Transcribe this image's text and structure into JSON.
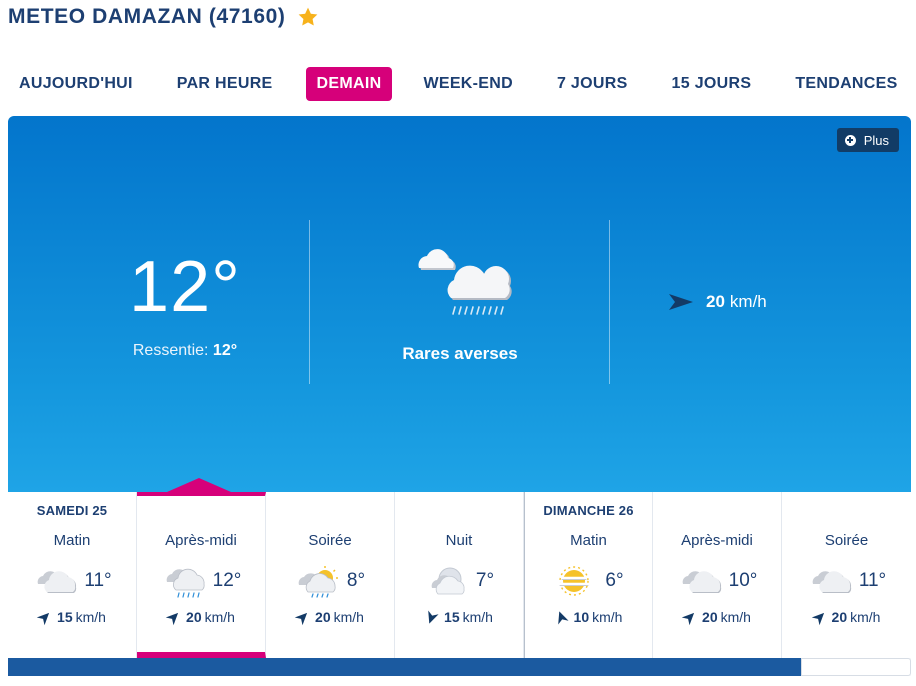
{
  "page": {
    "title": "METEO DAMAZAN (47160)",
    "favorite_icon": "star-icon",
    "accent_color": "#d6007a",
    "brand_color": "#1d3f72"
  },
  "tabs": [
    {
      "label": "AUJOURD'HUI",
      "active": false
    },
    {
      "label": "PAR HEURE",
      "active": false
    },
    {
      "label": "DEMAIN",
      "active": true
    },
    {
      "label": "WEEK-END",
      "active": false
    },
    {
      "label": "7 JOURS",
      "active": false
    },
    {
      "label": "15 JOURS",
      "active": false
    },
    {
      "label": "TENDANCES",
      "active": false
    }
  ],
  "hero": {
    "plus_label": "Plus",
    "temperature": "12°",
    "feels_label": "Ressentie:",
    "feels_value": "12°",
    "icon": "cloud-shower-icon",
    "description": "Rares averses",
    "wind_speed": "20",
    "wind_unit": "km/h"
  },
  "forecast": [
    {
      "day": "SAMEDI 25",
      "period": "Matin",
      "icon": "cloudy-icon",
      "temp": "11°",
      "wind": "15",
      "unit": "km/h",
      "selected": false,
      "wind_dir": 135
    },
    {
      "day": "",
      "period": "Après-midi",
      "icon": "cloud-shower-icon",
      "temp": "12°",
      "wind": "20",
      "unit": "km/h",
      "selected": true,
      "wind_dir": 135
    },
    {
      "day": "",
      "period": "Soirée",
      "icon": "partly-sunny-shower-icon",
      "temp": "8°",
      "wind": "20",
      "unit": "km/h",
      "selected": false,
      "wind_dir": 225
    },
    {
      "day": "",
      "period": "Nuit",
      "icon": "moon-cloud-icon",
      "temp": "7°",
      "wind": "15",
      "unit": "km/h",
      "selected": false,
      "wind_dir": 200
    },
    {
      "day": "DIMANCHE 26",
      "period": "Matin",
      "icon": "sun-fog-icon",
      "temp": "6°",
      "wind": "10",
      "unit": "km/h",
      "selected": false,
      "wind_dir": 135
    },
    {
      "day": "",
      "period": "Après-midi",
      "icon": "cloudy-icon",
      "temp": "10°",
      "wind": "20",
      "unit": "km/h",
      "selected": false,
      "wind_dir": 135
    },
    {
      "day": "",
      "period": "Soirée",
      "icon": "cloudy-icon",
      "temp": "11°",
      "wind": "20",
      "unit": "km/h",
      "selected": false,
      "wind_dir": 135
    }
  ]
}
